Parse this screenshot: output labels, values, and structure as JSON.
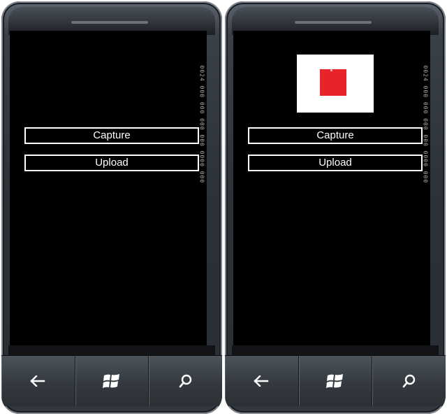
{
  "phones": [
    {
      "id": "left",
      "buttons": {
        "capture_label": "Capture",
        "upload_label": "Upload"
      },
      "debug_counter": "0024 000 000 000 000 0000 000",
      "has_preview": false
    },
    {
      "id": "right",
      "buttons": {
        "capture_label": "Capture",
        "upload_label": "Upload"
      },
      "debug_counter": "0024 000 000 000 000 0000 000",
      "has_preview": true,
      "preview": {
        "background_color": "#ffffff",
        "shape_color": "#e8232a"
      }
    }
  ],
  "navbar": {
    "back_icon": "back-arrow-icon",
    "start_icon": "windows-logo-icon",
    "search_icon": "search-icon"
  },
  "colors": {
    "screen_background": "#000000",
    "button_border": "#ffffff",
    "button_text": "#ffffff",
    "bezel": "#2c3138"
  }
}
